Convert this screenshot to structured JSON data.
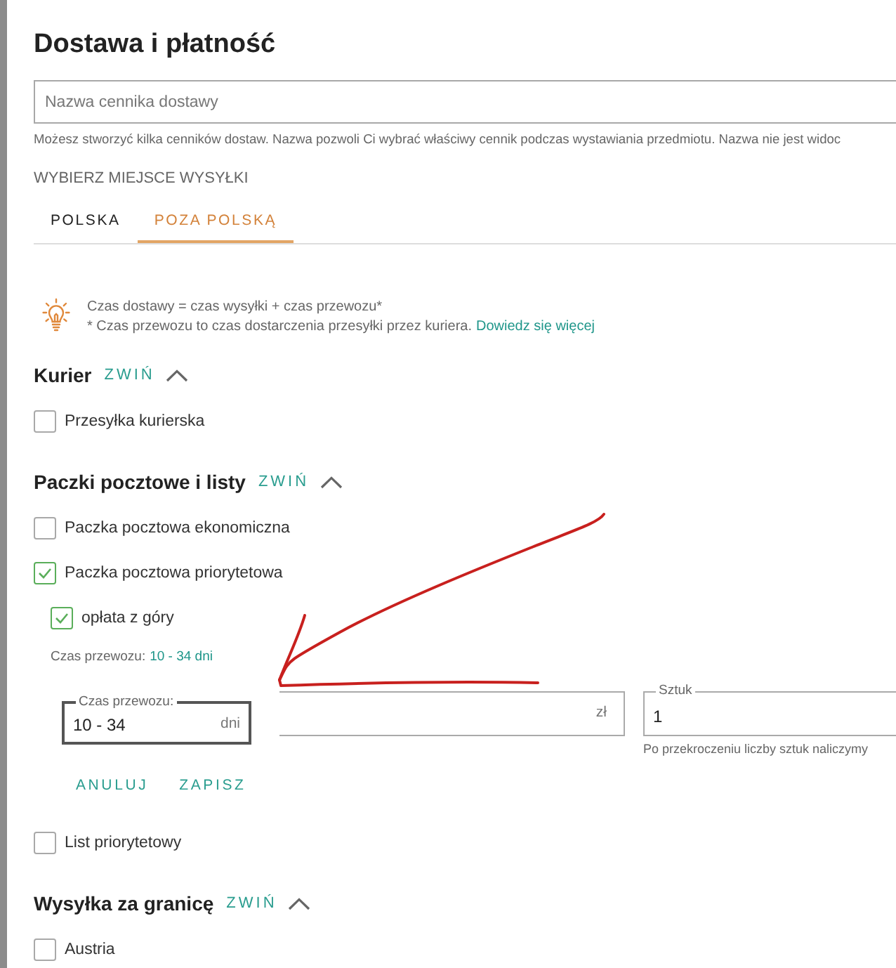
{
  "page_title": "Dostawa i płatność",
  "price_list_name": {
    "placeholder": "Nazwa cennika dostawy",
    "hint": "Możesz stworzyć kilka cenników dostaw. Nazwa pozwoli Ci wybrać właściwy cennik podczas wystawiania przedmiotu. Nazwa nie jest widoc"
  },
  "shipping_origin": {
    "label": "WYBIERZ MIEJSCE WYSYŁKI",
    "tabs": [
      {
        "label": "POLSKA",
        "selected": false
      },
      {
        "label": "POZA POLSKĄ",
        "selected": true
      }
    ]
  },
  "info": {
    "formula": "Czas dostawy = czas wysyłki + czas przewozu*",
    "footnote": "* Czas przewozu to czas dostarczenia przesyłki przez kuriera.",
    "link": "Dowiedz się więcej"
  },
  "sections": [
    {
      "title": "Kurier",
      "toggle": "ZWIŃ",
      "expanded": true,
      "options": [
        {
          "label": "Przesyłka kurierska",
          "checked": false
        }
      ]
    },
    {
      "title": "Paczki pocztowe i listy",
      "toggle": "ZWIŃ",
      "expanded": true,
      "options": [
        {
          "label": "Paczka pocztowa ekonomiczna",
          "checked": false
        },
        {
          "label": "Paczka pocztowa priorytetowa",
          "checked": true,
          "details": {
            "prepaid": {
              "label": "opłata z góry",
              "checked": true
            },
            "transit_summary": {
              "label": "Czas przewozu:",
              "value": "10 - 34 dni"
            },
            "transit_field": {
              "label": "Czas przewozu:",
              "value": "10 - 34",
              "unit": "dni",
              "focused": true
            },
            "price_field": {
              "unit": "zł"
            },
            "quantity_field": {
              "label": "Sztuk",
              "value": "1",
              "hint": "Po przekroczeniu liczby sztuk naliczymy"
            },
            "actions": [
              "ANULUJ",
              "ZAPISZ"
            ]
          }
        },
        {
          "label": "List priorytetowy",
          "checked": false
        }
      ]
    },
    {
      "title": "Wysyłka za granicę",
      "toggle": "ZWIŃ",
      "expanded": true,
      "options": [
        {
          "label": "Austria",
          "checked": false
        }
      ]
    }
  ]
}
